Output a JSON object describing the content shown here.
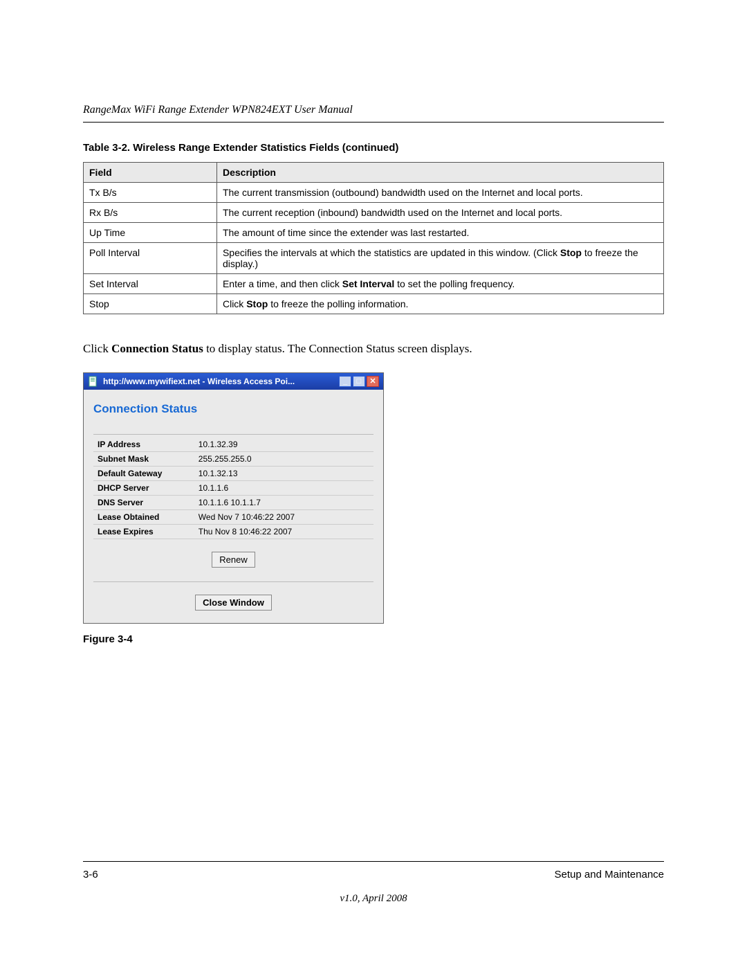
{
  "header": {
    "title": "RangeMax WiFi Range Extender WPN824EXT User Manual"
  },
  "table": {
    "caption": "Table 3-2.  Wireless Range Extender Statistics Fields (continued)",
    "headers": {
      "field": "Field",
      "description": "Description"
    },
    "rows": [
      {
        "field": "Tx B/s",
        "desc": "The current transmission (outbound) bandwidth used on the Internet and local ports."
      },
      {
        "field": "Rx B/s",
        "desc": "The current reception (inbound) bandwidth used on the Internet and local ports."
      },
      {
        "field": "Up Time",
        "desc": "The amount of time since the extender was last restarted."
      },
      {
        "field": "Poll Interval",
        "desc_pre": "Specifies the intervals at which the statistics are updated in this window. (Click ",
        "desc_bold": "Stop",
        "desc_post": " to freeze the display.)"
      },
      {
        "field": "Set Interval",
        "desc_pre": "Enter a time, and then click ",
        "desc_bold": "Set Interval",
        "desc_post": " to set the polling frequency."
      },
      {
        "field": "Stop",
        "desc_pre": "Click ",
        "desc_bold": "Stop",
        "desc_post": " to freeze the polling information."
      }
    ]
  },
  "body": {
    "pre": "Click ",
    "bold": "Connection Status",
    "post": " to display status. The Connection Status screen displays."
  },
  "window": {
    "titlebar": "http://www.mywifiext.net - Wireless Access Poi...",
    "heading": "Connection Status",
    "rows": [
      {
        "label": "IP Address",
        "value": "10.1.32.39"
      },
      {
        "label": "Subnet Mask",
        "value": "255.255.255.0"
      },
      {
        "label": "Default Gateway",
        "value": "10.1.32.13"
      },
      {
        "label": "DHCP Server",
        "value": "10.1.1.6"
      },
      {
        "label": "DNS Server",
        "value": "10.1.1.6   10.1.1.7"
      },
      {
        "label": "Lease Obtained",
        "value": "Wed Nov 7 10:46:22 2007"
      },
      {
        "label": "Lease Expires",
        "value": "Thu Nov 8 10:46:22 2007"
      }
    ],
    "renew": "Renew",
    "close": "Close Window"
  },
  "figure_caption": "Figure 3-4",
  "footer": {
    "page": "3-6",
    "section": "Setup and Maintenance",
    "version": "v1.0, April 2008"
  }
}
